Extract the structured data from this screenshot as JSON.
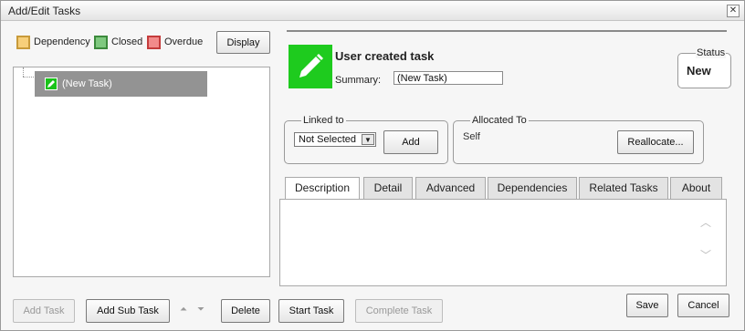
{
  "window": {
    "title": "Add/Edit Tasks",
    "close_glyph": "✕"
  },
  "legend": [
    {
      "label": "Dependency",
      "fill": "#f7cf7a",
      "border": "#c89a3a"
    },
    {
      "label": "Closed",
      "fill": "#7fc97f",
      "border": "#3c8a3c"
    },
    {
      "label": "Overdue",
      "fill": "#f28b8b",
      "border": "#c43c3c"
    }
  ],
  "display_button": "Display",
  "tree": {
    "items": [
      {
        "label": "(New Task)",
        "icon": "pencil-icon"
      }
    ]
  },
  "task": {
    "heading": "User created task",
    "summary_label": "Summary:",
    "summary_value": "(New Task)",
    "icon": "pencil-icon",
    "icon_color": "#1ecb1e"
  },
  "status": {
    "legend": "Status",
    "value": "New"
  },
  "linked_to": {
    "legend": "Linked to",
    "selected": "Not Selected",
    "add_button": "Add"
  },
  "allocated_to": {
    "legend": "Allocated To",
    "value": "Self",
    "reallocate_button": "Reallocate..."
  },
  "tabs": [
    {
      "label": "Description",
      "active": true
    },
    {
      "label": "Detail",
      "active": false
    },
    {
      "label": "Advanced",
      "active": false
    },
    {
      "label": "Dependencies",
      "active": false
    },
    {
      "label": "Related Tasks",
      "active": false
    },
    {
      "label": "About",
      "active": false
    }
  ],
  "description_text": "",
  "footer": {
    "add_task": "Add Task",
    "add_sub_task": "Add Sub Task",
    "move_up_glyph": "⏶",
    "move_down_glyph": "⏷",
    "delete": "Delete",
    "start_task": "Start Task",
    "complete_task": "Complete Task",
    "save": "Save",
    "cancel": "Cancel"
  }
}
